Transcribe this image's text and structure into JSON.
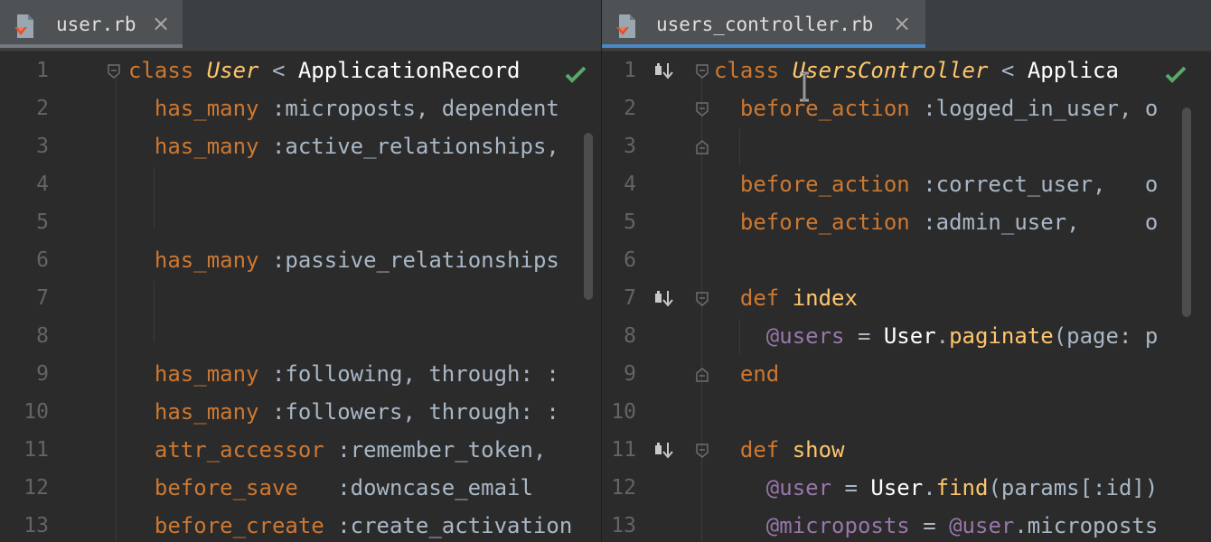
{
  "colors": {
    "keyword": "#cc7832",
    "method": "#ffc66d",
    "symbol": "#a9b7c6",
    "ivar": "#9876aa",
    "background": "#2b2b2b",
    "line_number": "#626466",
    "check": "#59a869",
    "active_tab_underline": "#4a88c7"
  },
  "left": {
    "tab": {
      "label": "user.rb",
      "icon": "ruby-file-icon",
      "close": "×"
    },
    "lines": [
      {
        "n": "1",
        "tokens": [
          {
            "t": "class ",
            "c": "kw"
          },
          {
            "t": "User",
            "c": "clsit"
          },
          {
            "t": " < ",
            "c": "plain"
          },
          {
            "t": "ApplicationRecord",
            "c": "cls"
          }
        ]
      },
      {
        "n": "2",
        "tokens": [
          {
            "t": "  has_many ",
            "c": "kw"
          },
          {
            "t": ":microposts",
            "c": "sym"
          },
          {
            "t": ", dependent",
            "c": "plain"
          }
        ]
      },
      {
        "n": "3",
        "tokens": [
          {
            "t": "  has_many ",
            "c": "kw"
          },
          {
            "t": ":active_relationships",
            "c": "sym"
          },
          {
            "t": ",",
            "c": "plain"
          }
        ]
      },
      {
        "n": "4",
        "tokens": []
      },
      {
        "n": "5",
        "tokens": []
      },
      {
        "n": "6",
        "tokens": [
          {
            "t": "  has_many ",
            "c": "kw"
          },
          {
            "t": ":passive_relationships",
            "c": "sym"
          }
        ]
      },
      {
        "n": "7",
        "tokens": []
      },
      {
        "n": "8",
        "tokens": []
      },
      {
        "n": "9",
        "tokens": [
          {
            "t": "  has_many ",
            "c": "kw"
          },
          {
            "t": ":following",
            "c": "sym"
          },
          {
            "t": ", through: :",
            "c": "plain"
          }
        ]
      },
      {
        "n": "10",
        "tokens": [
          {
            "t": "  has_many ",
            "c": "kw"
          },
          {
            "t": ":followers",
            "c": "sym"
          },
          {
            "t": ", through: :",
            "c": "plain"
          }
        ]
      },
      {
        "n": "11",
        "tokens": [
          {
            "t": "  attr_accessor ",
            "c": "kw"
          },
          {
            "t": ":remember_token",
            "c": "sym"
          },
          {
            "t": ",",
            "c": "plain"
          }
        ]
      },
      {
        "n": "12",
        "tokens": [
          {
            "t": "  before_save   ",
            "c": "kw"
          },
          {
            "t": ":downcase_email",
            "c": "sym"
          }
        ]
      },
      {
        "n": "13",
        "tokens": [
          {
            "t": "  before_create ",
            "c": "kw"
          },
          {
            "t": ":create_activation",
            "c": "sym"
          }
        ]
      }
    ]
  },
  "right": {
    "tab": {
      "label": "users_controller.rb",
      "icon": "ruby-file-icon",
      "close": "×"
    },
    "lines": [
      {
        "n": "1",
        "tokens": [
          {
            "t": "class ",
            "c": "kw"
          },
          {
            "t": "UsersController",
            "c": "clsit"
          },
          {
            "t": " < ",
            "c": "plain"
          },
          {
            "t": "Applica",
            "c": "cls"
          }
        ]
      },
      {
        "n": "2",
        "tokens": [
          {
            "t": "  before_action ",
            "c": "kw"
          },
          {
            "t": ":logged_in_user",
            "c": "sym"
          },
          {
            "t": ", o",
            "c": "plain"
          }
        ]
      },
      {
        "n": "3",
        "tokens": []
      },
      {
        "n": "4",
        "tokens": [
          {
            "t": "  before_action ",
            "c": "kw"
          },
          {
            "t": ":correct_user",
            "c": "sym"
          },
          {
            "t": ",   o",
            "c": "plain"
          }
        ]
      },
      {
        "n": "5",
        "tokens": [
          {
            "t": "  before_action ",
            "c": "kw"
          },
          {
            "t": ":admin_user",
            "c": "sym"
          },
          {
            "t": ",     o",
            "c": "plain"
          }
        ]
      },
      {
        "n": "6",
        "tokens": []
      },
      {
        "n": "7",
        "tokens": [
          {
            "t": "  def ",
            "c": "kw"
          },
          {
            "t": "index",
            "c": "meth"
          }
        ]
      },
      {
        "n": "8",
        "tokens": [
          {
            "t": "    @users",
            "c": "ivar"
          },
          {
            "t": " = ",
            "c": "plain"
          },
          {
            "t": "User",
            "c": "cls"
          },
          {
            "t": ".",
            "c": "plain"
          },
          {
            "t": "paginate",
            "c": "meth"
          },
          {
            "t": "(page: p",
            "c": "plain"
          }
        ]
      },
      {
        "n": "9",
        "tokens": [
          {
            "t": "  end",
            "c": "kw"
          }
        ]
      },
      {
        "n": "10",
        "tokens": []
      },
      {
        "n": "11",
        "tokens": [
          {
            "t": "  def ",
            "c": "kw"
          },
          {
            "t": "show",
            "c": "meth"
          }
        ]
      },
      {
        "n": "12",
        "tokens": [
          {
            "t": "    @user",
            "c": "ivar"
          },
          {
            "t": " = ",
            "c": "plain"
          },
          {
            "t": "User",
            "c": "cls"
          },
          {
            "t": ".",
            "c": "plain"
          },
          {
            "t": "find",
            "c": "meth"
          },
          {
            "t": "(params[:id])",
            "c": "plain"
          }
        ]
      },
      {
        "n": "13",
        "tokens": [
          {
            "t": "    @microposts",
            "c": "ivar"
          },
          {
            "t": " = ",
            "c": "plain"
          },
          {
            "t": "@user",
            "c": "ivar"
          },
          {
            "t": ".microposts",
            "c": "plain"
          }
        ]
      }
    ]
  }
}
